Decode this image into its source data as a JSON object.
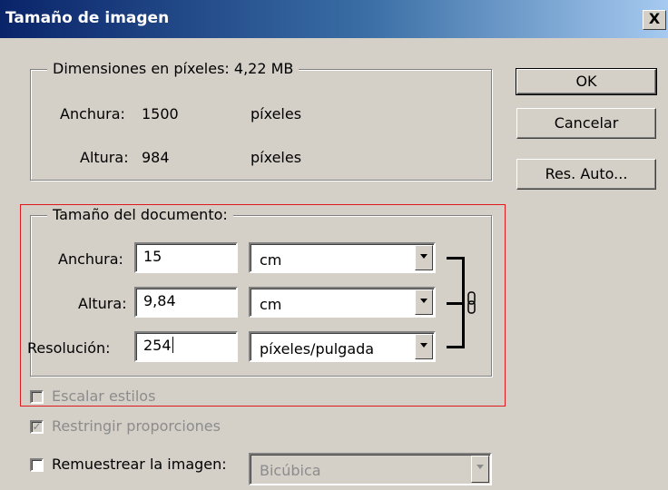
{
  "window": {
    "title": "Tamaño de imagen",
    "close_symbol": "X"
  },
  "pixel_dimensions": {
    "legend": "Dimensiones en píxeles: 4,22 MB",
    "width_label": "Anchura:",
    "width_value": "1500",
    "width_unit": "píxeles",
    "height_label": "Altura:",
    "height_value": "984",
    "height_unit": "píxeles"
  },
  "document_size": {
    "legend": "Tamaño del documento:",
    "width_label": "Anchura:",
    "width_value": "15",
    "width_unit": "cm",
    "height_label": "Altura:",
    "height_value": "9,84",
    "height_unit": "cm",
    "resolution_label": "Resolución:",
    "resolution_value": "254",
    "resolution_unit": "píxeles/pulgada",
    "link_icon": "chain-link-icon"
  },
  "options": {
    "scale_styles": {
      "label": "Escalar estilos",
      "checked": false,
      "enabled": false
    },
    "constrain_proportions": {
      "label": "Restringir proporciones",
      "checked": true,
      "enabled": false
    },
    "resample": {
      "label": "Remuestrear la imagen:",
      "checked": false,
      "enabled": true
    },
    "resample_method": "Bicúbica"
  },
  "buttons": {
    "ok": "OK",
    "cancel": "Cancelar",
    "auto": "Res. Auto..."
  },
  "colors": {
    "titlebar_start": "#0a246a",
    "dialog_bg": "#d4d0c8",
    "highlight_frame": "#e0191f"
  }
}
